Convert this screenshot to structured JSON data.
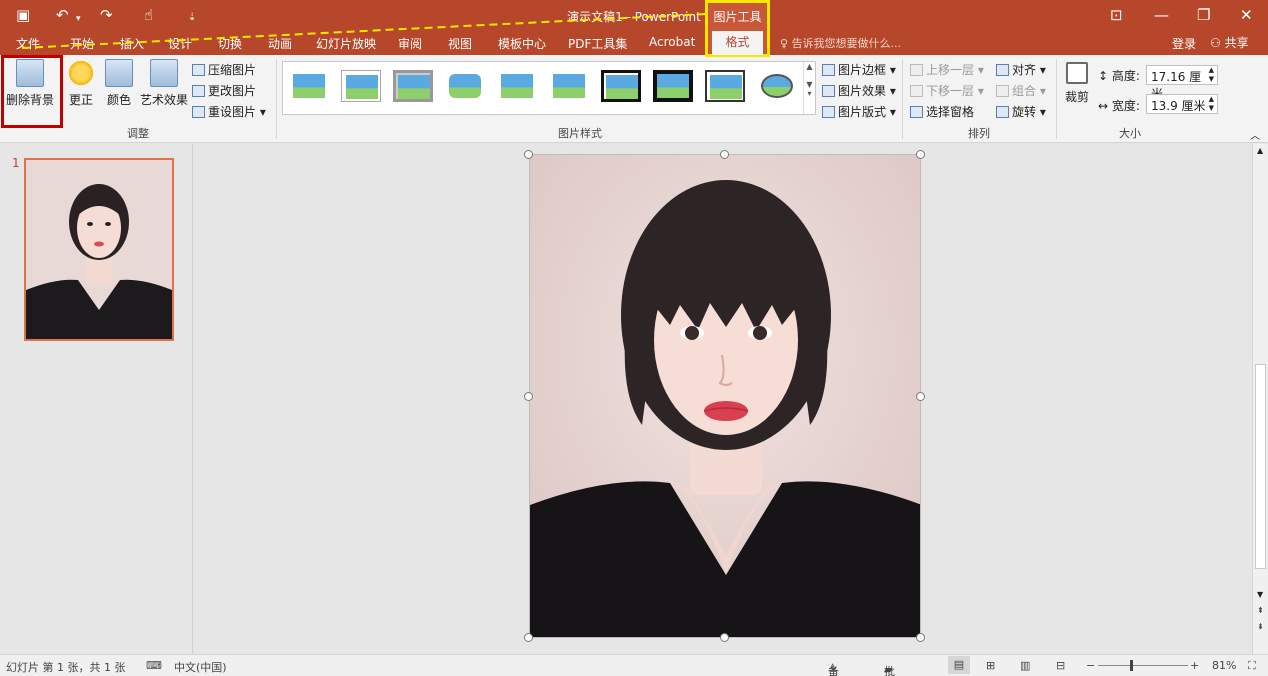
{
  "app": {
    "window_title": "演示文稿1 - PowerPoint",
    "context_group": "图片工具",
    "context_tab": "格式",
    "tell_me": "告诉我您想要做什么...",
    "login": "登录",
    "share": "共享"
  },
  "tabs": [
    "文件",
    "开始",
    "插入",
    "设计",
    "切换",
    "动画",
    "幻灯片放映",
    "审阅",
    "视图",
    "模板中心",
    "PDF工具集",
    "Acrobat"
  ],
  "ribbon": {
    "adjust": {
      "remove_bg": "删除背景",
      "corrections": "更正",
      "color": "颜色",
      "artistic": "艺术效果",
      "compress": "压缩图片",
      "change": "更改图片",
      "reset": "重设图片",
      "group_label": "调整"
    },
    "styles": {
      "border": "图片边框",
      "effects": "图片效果",
      "layout": "图片版式",
      "group_label": "图片样式"
    },
    "arrange": {
      "bring_forward": "上移一层",
      "send_backward": "下移一层",
      "selection_pane": "选择窗格",
      "align": "对齐",
      "group": "组合",
      "rotate": "旋转",
      "group_label": "排列"
    },
    "size": {
      "crop": "裁剪",
      "height_label": "高度:",
      "height_value": "17.16 厘米",
      "width_label": "宽度:",
      "width_value": "13.9 厘米",
      "group_label": "大小"
    }
  },
  "slides": {
    "number": "1"
  },
  "status": {
    "slide_info": "幻灯片 第 1 张，共 1 张",
    "language": "中文(中国)",
    "notes": "备注",
    "comments": "批注",
    "zoom": "81%"
  },
  "colors": {
    "accent": "#b7472a",
    "highlight_yellow": "#f5e900",
    "highlight_red": "#c00000"
  }
}
